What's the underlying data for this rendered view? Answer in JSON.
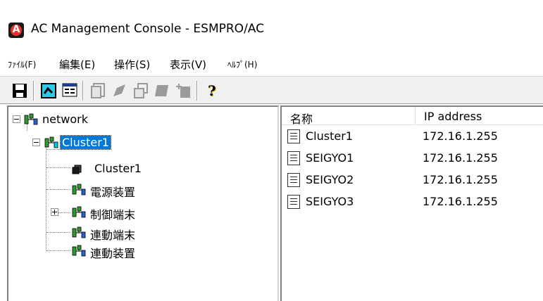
{
  "window": {
    "title": "AC Management Console - ESMPRO/AC"
  },
  "menu": [
    {
      "label": "ﾌｧｲﾙ(F)",
      "small": true
    },
    {
      "label": "編集(E)",
      "small": false
    },
    {
      "label": "操作(S)",
      "small": false
    },
    {
      "label": "表示(V)",
      "small": false
    },
    {
      "label": "ﾍﾙﾌﾟ(H)",
      "small": true
    }
  ],
  "toolbar": {
    "buttons": [
      "save-icon",
      "network-view-icon",
      "properties-icon",
      "copy-icon",
      "edit-icon",
      "duplicate-icon",
      "stack-icon",
      "add-icon",
      "help-icon"
    ],
    "help_glyph": "?"
  },
  "tree": {
    "root": "network",
    "cluster": "Cluster1",
    "cluster_child": "Cluster1",
    "power": "電源装置",
    "control": "制御端末",
    "linked_terminal": "連動端末",
    "linked_device": "連動装置"
  },
  "list": {
    "columns": [
      "名称",
      "IP address"
    ],
    "rows": [
      {
        "name": "Cluster1",
        "ip": "172.16.1.255"
      },
      {
        "name": "SEIGYO1",
        "ip": "172.16.1.255"
      },
      {
        "name": "SEIGYO2",
        "ip": "172.16.1.255"
      },
      {
        "name": "SEIGYO3",
        "ip": "172.16.1.255"
      }
    ]
  },
  "colors": {
    "selection": "#0078d7",
    "net_green": "#2e9b2e",
    "net_blue": "#2a5fd6",
    "net_cyan": "#00c8e8"
  }
}
